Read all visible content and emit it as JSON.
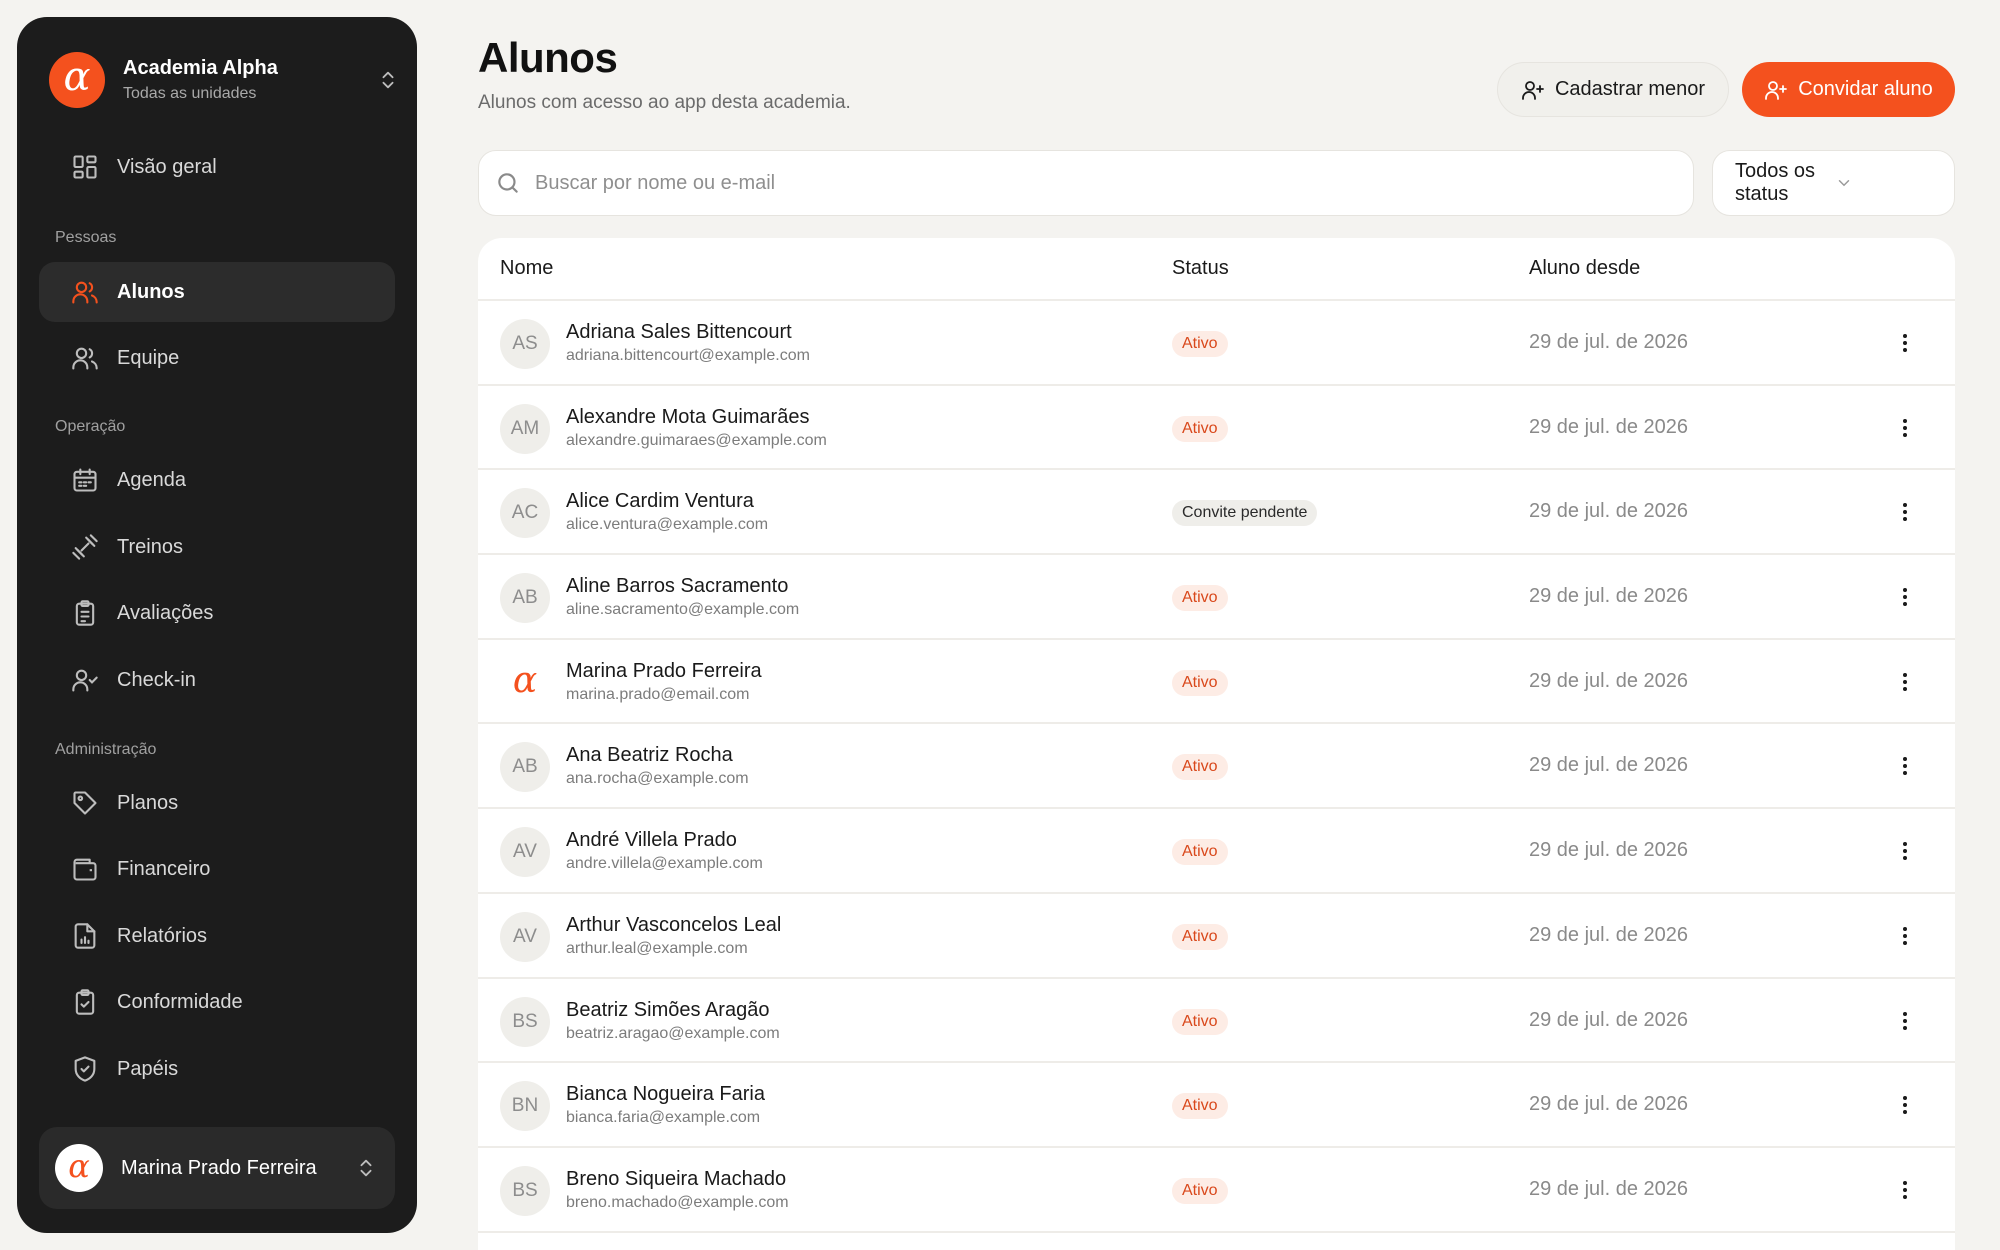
{
  "org": {
    "name": "Academia Alpha",
    "subtitle": "Todas as unidades",
    "logo_glyph": "α"
  },
  "nav": {
    "overview": "Visão geral",
    "section_people": "Pessoas",
    "students": "Alunos",
    "team": "Equipe",
    "section_operation": "Operação",
    "schedule": "Agenda",
    "workouts": "Treinos",
    "assessments": "Avaliações",
    "checkin": "Check-in",
    "section_admin": "Administração",
    "plans": "Planos",
    "finance": "Financeiro",
    "reports": "Relatórios",
    "compliance": "Conformidade",
    "roles": "Papéis"
  },
  "user": {
    "name": "Marina Prado Ferreira",
    "avatar_glyph": "α"
  },
  "header": {
    "title": "Alunos",
    "subtitle": "Alunos com acesso ao app desta academia.",
    "register_minor": "Cadastrar menor",
    "invite_student": "Convidar aluno"
  },
  "search": {
    "placeholder": "Buscar por nome ou e-mail",
    "value": ""
  },
  "filter": {
    "selected": "Todos os status"
  },
  "table": {
    "columns": {
      "name": "Nome",
      "status": "Status",
      "since": "Aluno desde"
    },
    "rows": [
      {
        "initials": "AS",
        "name": "Adriana Sales Bittencourt",
        "email": "adriana.bittencourt@example.com",
        "status": "Ativo",
        "since": "29 de jul. de 2026"
      },
      {
        "initials": "AM",
        "name": "Alexandre Mota Guimarães",
        "email": "alexandre.guimaraes@example.com",
        "status": "Ativo",
        "since": "29 de jul. de 2026"
      },
      {
        "initials": "AC",
        "name": "Alice Cardim Ventura",
        "email": "alice.ventura@example.com",
        "status": "Convite pendente",
        "since": "29 de jul. de 2026"
      },
      {
        "initials": "AB",
        "name": "Aline Barros Sacramento",
        "email": "aline.sacramento@example.com",
        "status": "Ativo",
        "since": "29 de jul. de 2026"
      },
      {
        "initials": "α",
        "name": "Marina Prado Ferreira",
        "email": "marina.prado@email.com",
        "status": "Ativo",
        "since": "29 de jul. de 2026"
      },
      {
        "initials": "AB",
        "name": "Ana Beatriz Rocha",
        "email": "ana.rocha@example.com",
        "status": "Ativo",
        "since": "29 de jul. de 2026"
      },
      {
        "initials": "AV",
        "name": "André Villela Prado",
        "email": "andre.villela@example.com",
        "status": "Ativo",
        "since": "29 de jul. de 2026"
      },
      {
        "initials": "AV",
        "name": "Arthur Vasconcelos Leal",
        "email": "arthur.leal@example.com",
        "status": "Ativo",
        "since": "29 de jul. de 2026"
      },
      {
        "initials": "BS",
        "name": "Beatriz Simões Aragão",
        "email": "beatriz.aragao@example.com",
        "status": "Ativo",
        "since": "29 de jul. de 2026"
      },
      {
        "initials": "BN",
        "name": "Bianca Nogueira Faria",
        "email": "bianca.faria@example.com",
        "status": "Ativo",
        "since": "29 de jul. de 2026"
      },
      {
        "initials": "BS",
        "name": "Breno Siqueira Machado",
        "email": "breno.machado@example.com",
        "status": "Ativo",
        "since": "29 de jul. de 2026"
      }
    ]
  },
  "colors": {
    "accent": "#f4511e",
    "sidebar": "#1c1c1c",
    "background": "#f4f3f0"
  }
}
